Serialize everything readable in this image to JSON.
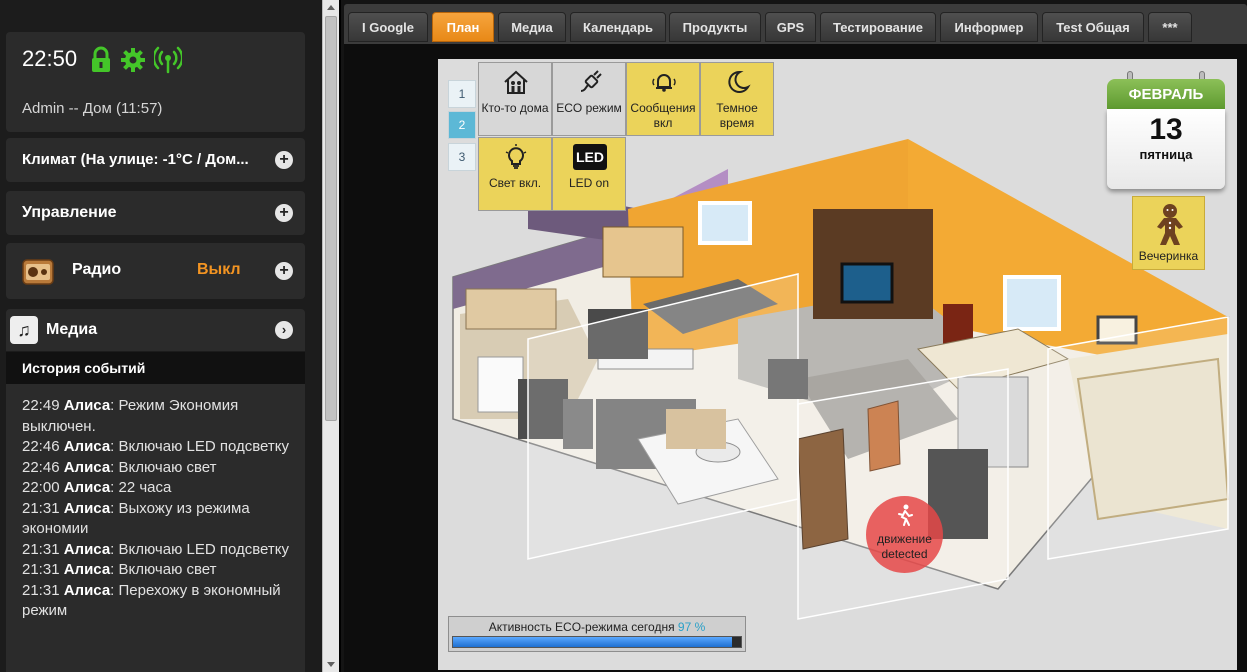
{
  "sidebar": {
    "time": "22:50",
    "user_line": "Admin -- Дом (11:57)",
    "climate_title": "Климат (На улице: -1°C / Дом...",
    "control_title": "Управление",
    "radio_title": "Радио",
    "radio_status": "Выкл",
    "media_title": "Медиа",
    "history_title": "История событий",
    "history": [
      {
        "time": "22:49",
        "who": "Алиса",
        "text": ": Режим Экономия выключен."
      },
      {
        "time": "22:46",
        "who": "Алиса",
        "text": ": Включаю LED подсветку"
      },
      {
        "time": "22:46",
        "who": "Алиса",
        "text": ": Включаю свет"
      },
      {
        "time": "22:00",
        "who": "Алиса",
        "text": ": 22 часа"
      },
      {
        "time": "21:31",
        "who": "Алиса",
        "text": ": Выхожу из режима экономии"
      },
      {
        "time": "21:31",
        "who": "Алиса",
        "text": ": Включаю LED подсветку"
      },
      {
        "time": "21:31",
        "who": "Алиса",
        "text": ": Включаю свет"
      },
      {
        "time": "21:31",
        "who": "Алиса",
        "text": ": Перехожу в экономный режим"
      }
    ]
  },
  "tabs": [
    {
      "label": "I Google"
    },
    {
      "label": "План"
    },
    {
      "label": "Медиа"
    },
    {
      "label": "Календарь"
    },
    {
      "label": "Продукты"
    },
    {
      "label": "GPS"
    },
    {
      "label": "Тестирование"
    },
    {
      "label": "Информер"
    },
    {
      "label": "Test Общая"
    },
    {
      "label": "***"
    }
  ],
  "active_tab": "План",
  "floors": [
    "1",
    "2",
    "3"
  ],
  "selected_floor": "2",
  "tiles": {
    "who_home": "Кто-то дома",
    "eco": "ECO режим",
    "messages": "Сообщения вкл",
    "dark": "Темное время",
    "light": "Свет вкл.",
    "led": "LED on",
    "led_icon_text": "LED"
  },
  "calendar": {
    "month": "ФЕВРАЛЬ",
    "day": "13",
    "weekday": "пятница"
  },
  "party_label": "Вечеринка",
  "motion": {
    "line1": "движение",
    "line2": "detected"
  },
  "eco_activity": {
    "label": "Активность ECO-режима сегодня",
    "value": "97",
    "unit": "%",
    "fraction": 0.97
  },
  "colors": {
    "accent": "#f39422",
    "green": "#44c629",
    "tile_yellow": "#ebd35a",
    "floor_selected": "#5cb8d6"
  }
}
